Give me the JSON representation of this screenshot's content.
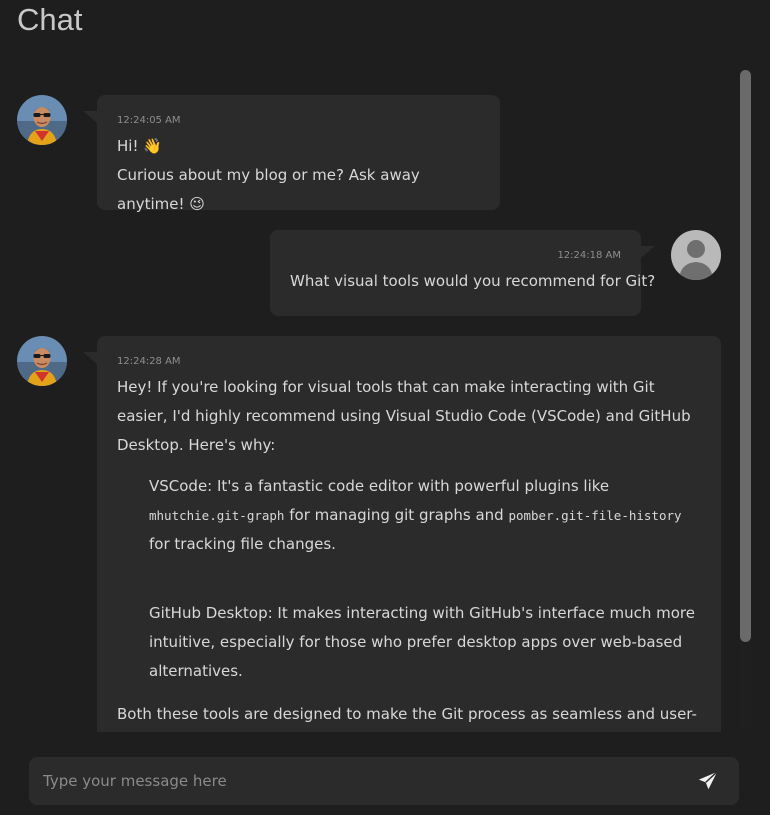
{
  "page": {
    "title": "Chat"
  },
  "messages": [
    {
      "role": "assistant",
      "timestamp": "12:24:05 AM",
      "lines": [
        "Hi! 👋",
        "Curious about my blog or me? Ask away anytime! 😉"
      ]
    },
    {
      "role": "user",
      "timestamp": "12:24:18 AM",
      "text": "What visual tools would you recommend for Git?"
    },
    {
      "role": "assistant",
      "timestamp": "12:24:28 AM",
      "intro": "Hey! If you're looking for visual tools that can make interacting with Git easier, I'd highly recommend using Visual Studio Code (VSCode) and GitHub Desktop. Here's why:",
      "item1": {
        "before": "VSCode: It's a fantastic code editor with powerful plugins like ",
        "code1": "mhutchie.git-graph",
        "middle": " for managing git graphs and ",
        "code2": "pomber.git-file-history",
        "after": " for tracking file changes."
      },
      "item2": "GitHub Desktop: It makes interacting with GitHub's interface much more intuitive, especially for those who prefer desktop apps over web-based alternatives.",
      "outro": "Both these tools are designed to make the Git process as seamless and user-friendly as possible."
    }
  ],
  "composer": {
    "placeholder": "Type your message here"
  },
  "icons": {
    "send": "send-icon",
    "user_avatar": "default-user-avatar",
    "bot_avatar": "assistant-avatar"
  },
  "colors": {
    "background": "#1e1e1f",
    "bubble": "#2b2b2c",
    "scrollbar": "#6a6a6a"
  }
}
